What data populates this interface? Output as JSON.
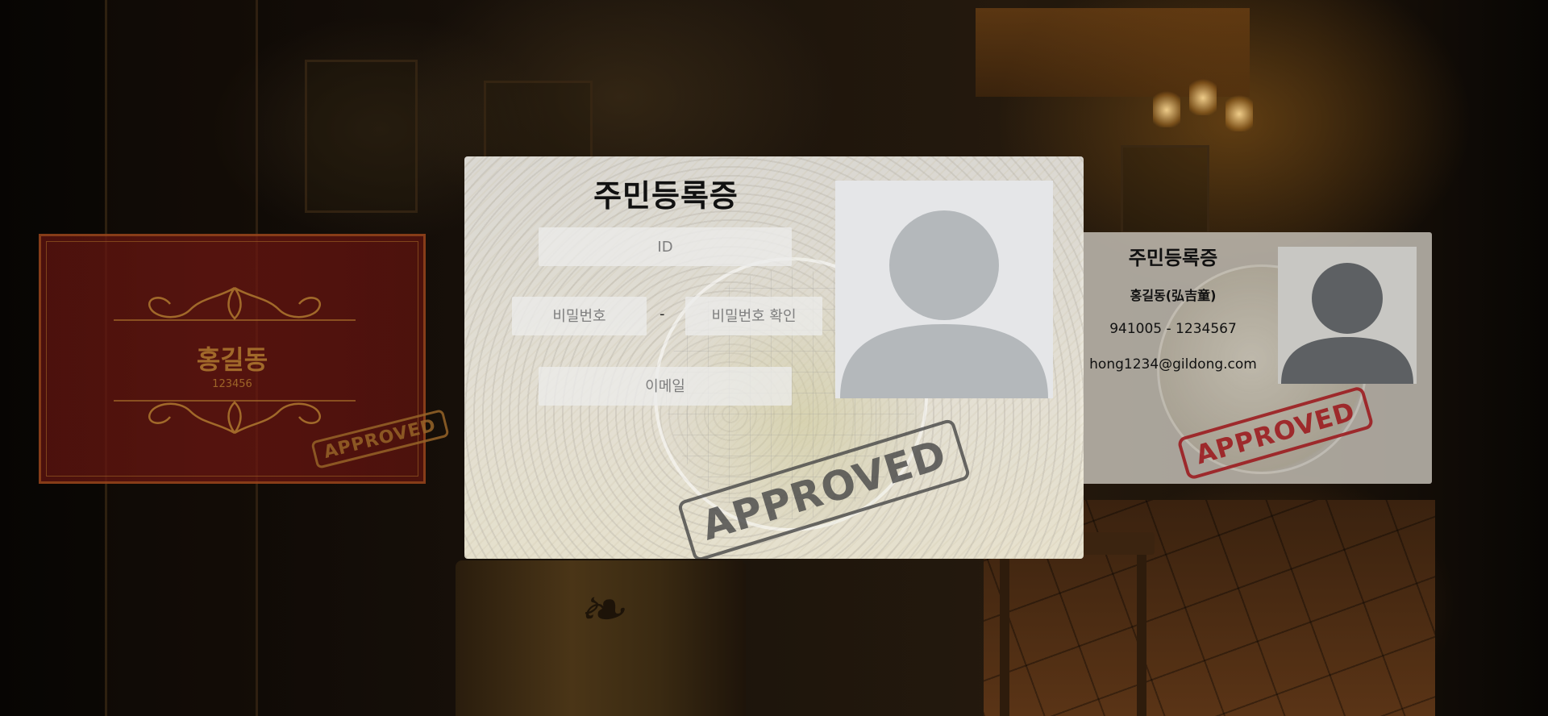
{
  "main_card": {
    "title": "주민등록증",
    "fields": {
      "id_placeholder": "ID",
      "password_placeholder": "비밀번호",
      "separator": "-",
      "password_confirm_placeholder": "비밀번호 확인",
      "email_placeholder": "이메일"
    },
    "stamp": "APPROVED"
  },
  "right_card": {
    "title": "주민등록증",
    "name": "홍길동(弘吉童)",
    "rrn": "941005 - 1234567",
    "email": "hong1234@gildong.com",
    "stamp": "APPROVED"
  },
  "left_card": {
    "name": "홍길동",
    "code": "123456",
    "stamp": "APPROVED"
  },
  "colors": {
    "stamp_red": "#9b1419",
    "stamp_gray": "#464646",
    "card_gold": "#aa732d",
    "card_maroon": "#5f140f"
  }
}
